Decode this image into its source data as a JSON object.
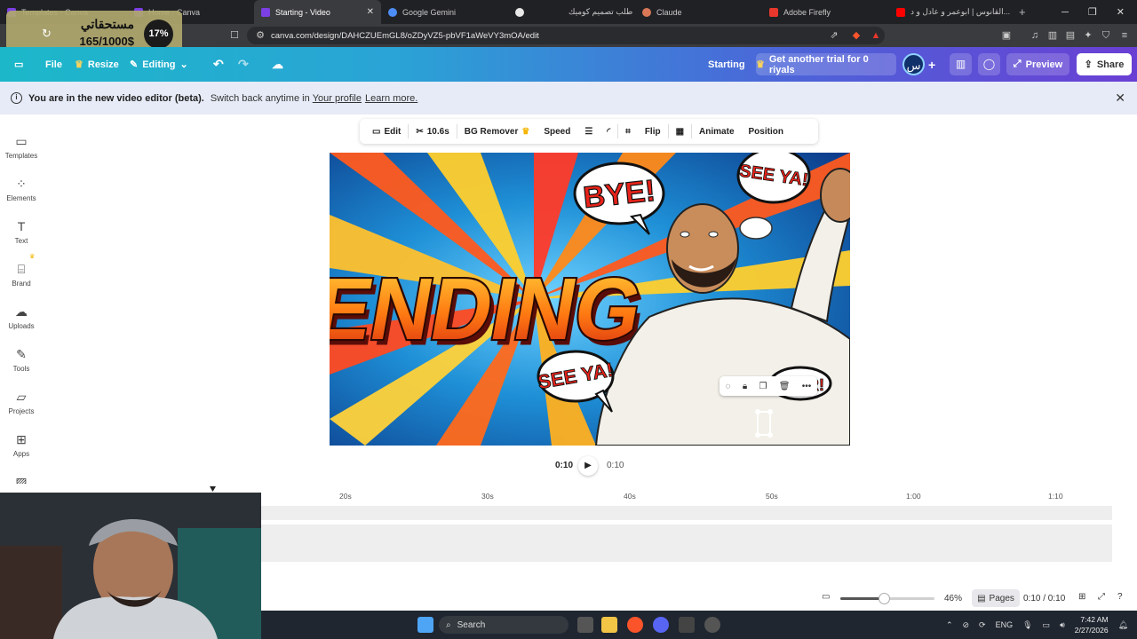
{
  "browser": {
    "tabs": [
      {
        "label": "Templates - Canva",
        "color": "#7b3fe4"
      },
      {
        "label": "Home - Canva",
        "color": "#7b3fe4"
      },
      {
        "label": "Starting - Video",
        "color": "#7b3fe4"
      },
      {
        "label": "Google Gemini",
        "color": "#4c8df6"
      },
      {
        "label": "طلب تصميم كوميك",
        "color": "#e8e8e8"
      },
      {
        "label": "Claude",
        "color": "#d97757"
      },
      {
        "label": "Adobe Firefly",
        "color": "#e8372c"
      },
      {
        "label": "القانوس | ابوعمر و عادل و د...",
        "color": "#ff0000"
      }
    ],
    "url": "canva.com/design/DAHCZUEmGL8/oZDyVZ5-pbVF1aWeVY3mOA/edit",
    "overlay": {
      "arabic": "مستحقاتي",
      "amount": "165/1000$",
      "percent": "17%"
    }
  },
  "header": {
    "file": "File",
    "resize": "Resize",
    "editing": "Editing",
    "doc_title": "Starting",
    "trial": "Get another trial for 0 riyals",
    "avatar": "س",
    "preview": "Preview",
    "share": "Share"
  },
  "banner": {
    "bold": "You are in the new video editor (beta).",
    "text": "Switch back anytime in",
    "link1": "Your profile",
    "link2": "Learn more."
  },
  "sidebar": {
    "items": [
      {
        "label": "Templates",
        "icon": "template-icon"
      },
      {
        "label": "Elements",
        "icon": "shapes-icon"
      },
      {
        "label": "Text",
        "icon": "text-icon"
      },
      {
        "label": "Brand",
        "icon": "briefcase-icon"
      },
      {
        "label": "Uploads",
        "icon": "cloud-upload-icon"
      },
      {
        "label": "Tools",
        "icon": "pen-icon"
      },
      {
        "label": "Projects",
        "icon": "folder-icon"
      },
      {
        "label": "Apps",
        "icon": "apps-icon"
      }
    ]
  },
  "toolbar": {
    "edit": "Edit",
    "duration": "10.6s",
    "bg_remover": "BG Remover",
    "speed": "Speed",
    "flip": "Flip",
    "animate": "Animate",
    "position": "Position"
  },
  "canvas": {
    "headline": "ENDING",
    "bubble_bye": "BYE!",
    "bubble_see_top": "SEE YA!",
    "bubble_see_left": "SEE YA!",
    "bubble_right": "...R!"
  },
  "playback": {
    "current": "0:10",
    "total": "0:10"
  },
  "timeline": {
    "ticks": [
      "20s",
      "30s",
      "40s",
      "50s",
      "1:00",
      "1:10"
    ]
  },
  "bottombar": {
    "zoom": "46%",
    "zoom_level": 0.46,
    "pages": "Pages",
    "time": "0:10 / 0:10"
  },
  "taskbar": {
    "search": "Search",
    "lang": "ENG",
    "time": "7:42 AM",
    "date": "2/27/2026"
  }
}
